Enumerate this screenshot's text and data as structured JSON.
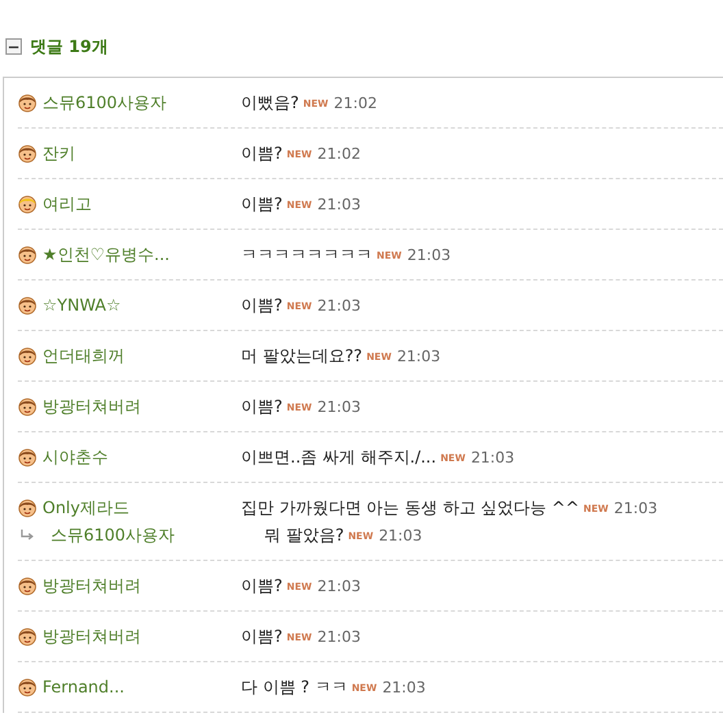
{
  "header": {
    "collapse_icon": "−",
    "title": "댓글 19개",
    "expanded": true
  },
  "comments": [
    {
      "author": "스뮤6100사용자",
      "kind": "brown",
      "text": "이뻤음?",
      "badge": "NEW",
      "time": "21:02"
    },
    {
      "author": "잔키",
      "kind": "brown",
      "text": "이쁨?",
      "badge": "NEW",
      "time": "21:02"
    },
    {
      "author": "여리고",
      "kind": "blond",
      "text": "이쁨?",
      "badge": "NEW",
      "time": "21:03"
    },
    {
      "author": "★인천♡유병수...",
      "kind": "brown",
      "text": "ㅋㅋㅋㅋㅋㅋㅋㅋ",
      "badge": "NEW",
      "time": "21:03"
    },
    {
      "author": "☆YNWA☆",
      "kind": "brown",
      "text": "이쁨?",
      "badge": "NEW",
      "time": "21:03"
    },
    {
      "author": "언더태희꺼",
      "kind": "brown",
      "text": "머 팔았는데요??",
      "badge": "NEW",
      "time": "21:03"
    },
    {
      "author": "방광터쳐버려",
      "kind": "brown",
      "text": "이쁨?",
      "badge": "NEW",
      "time": "21:03"
    },
    {
      "author": "시야춘수",
      "kind": "brown",
      "text": "이쁘면..좀 싸게 해주지./...",
      "badge": "NEW",
      "time": "21:03"
    },
    {
      "author": "Only제라드",
      "kind": "brown",
      "text": "집만 가까웠다면 아는 동생 하고 싶었다능 ^^",
      "badge": "NEW",
      "time": "21:03",
      "replies": [
        {
          "author": "스뮤6100사용자",
          "text": "뭐 팔았음?",
          "badge": "NEW",
          "time": "21:03"
        }
      ]
    },
    {
      "author": "방광터쳐버려",
      "kind": "brown",
      "text": "이쁨?",
      "badge": "NEW",
      "time": "21:03"
    },
    {
      "author": "방광터쳐버려",
      "kind": "brown",
      "text": "이쁨?",
      "badge": "NEW",
      "time": "21:03"
    },
    {
      "author": "Fernand...",
      "kind": "brown",
      "text": "다 이쁨 ? ㅋㅋ",
      "badge": "NEW",
      "time": "21:03"
    }
  ]
}
